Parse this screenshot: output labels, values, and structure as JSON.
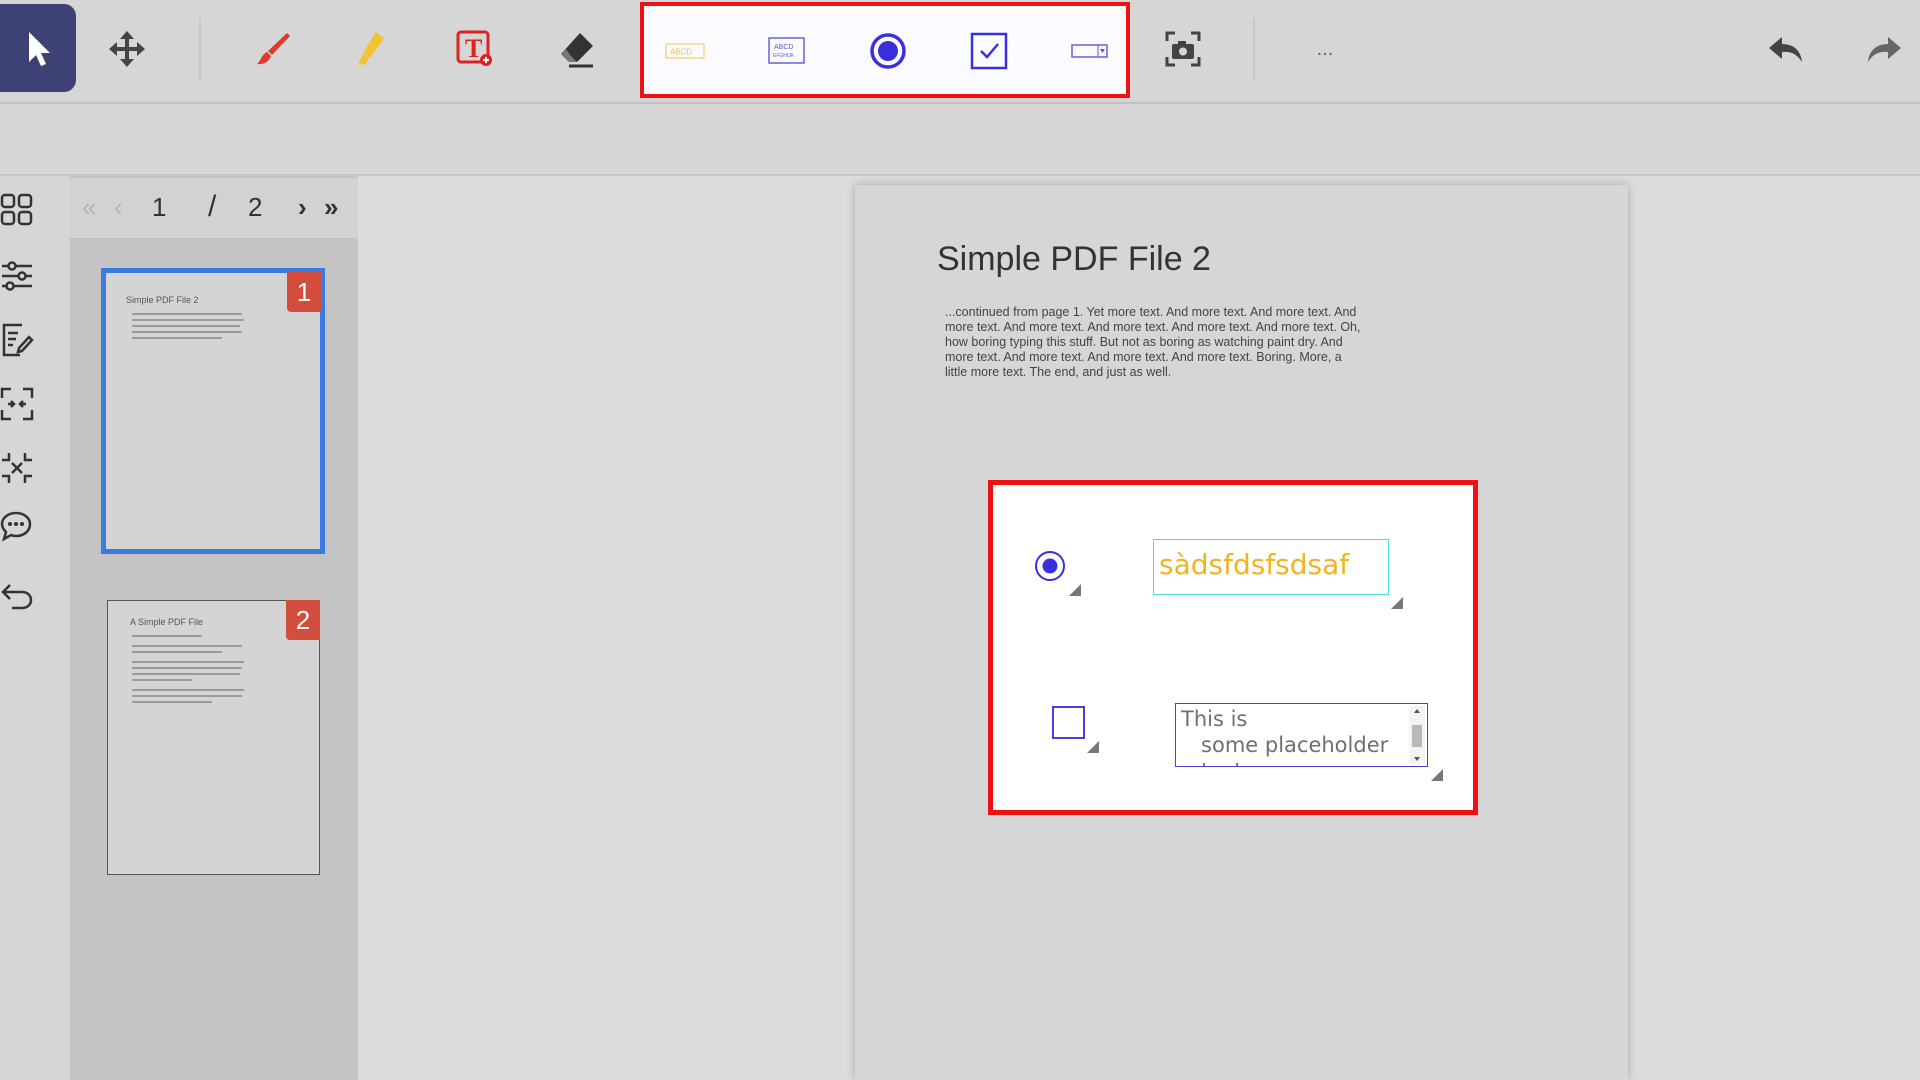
{
  "toolbar": {
    "tools": [
      "select-tool",
      "move-tool",
      "brush-tool",
      "highlighter-tool",
      "add-text-tool",
      "eraser-tool"
    ],
    "form_tools": {
      "text_field_preview": "ABCD",
      "textarea_preview_line1": "ABCD",
      "textarea_preview_line2": "EFGHIJK"
    },
    "more_label": "...",
    "accent_color": "#3d4176",
    "highlight_box_color": "#ef1111"
  },
  "pager": {
    "current_page": "1",
    "separator": "/",
    "total_pages": "2"
  },
  "thumbnails": [
    {
      "badge": "1",
      "title": "Simple PDF File 2",
      "selected": true
    },
    {
      "badge": "2",
      "title": "A Simple PDF File",
      "selected": false
    }
  ],
  "document": {
    "title": "Simple PDF File 2",
    "body": "...continued from page 1. Yet more text. And more text. And more text. And more text. And more text. And more text. And more text. And more text. Oh, how boring typing this stuff. But not as boring as watching paint dry. And more text. And more text. And more text. And more text. Boring.  More, a little more text. The end, and just as well."
  },
  "form_fields": {
    "radio_selected": true,
    "text_field_value": "sàdsfdsfsdsaf",
    "text_field_color": "#f0b420",
    "checkbox_checked": false,
    "textarea_value": "This is\n   some placeholder\n   text"
  }
}
